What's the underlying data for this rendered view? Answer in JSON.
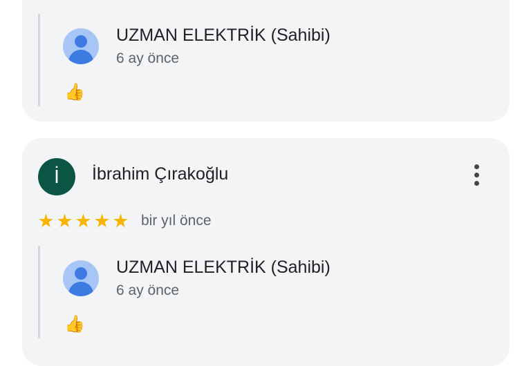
{
  "replies": [
    {
      "owner_name": "UZMAN ELEKTRİK (Sahibi)",
      "time": "6 ay önce",
      "thumb_icon": "👍"
    },
    {
      "owner_name": "UZMAN ELEKTRİK (Sahibi)",
      "time": "6 ay önce",
      "thumb_icon": "👍"
    }
  ],
  "review": {
    "avatar_letter": "İ",
    "user_name": "İbrahim Çırakoğlu",
    "rating": 5,
    "rating_max": 5,
    "time": "bir yıl önce",
    "menu_icon": "more-vert-icon"
  },
  "colors": {
    "card_bg": "#f2f4f6",
    "avatar_user_bg": "#0c5545",
    "owner_avatar_bg": "#a7c5f5",
    "owner_avatar_fg": "#3d7be0",
    "star": "#f7b500"
  }
}
